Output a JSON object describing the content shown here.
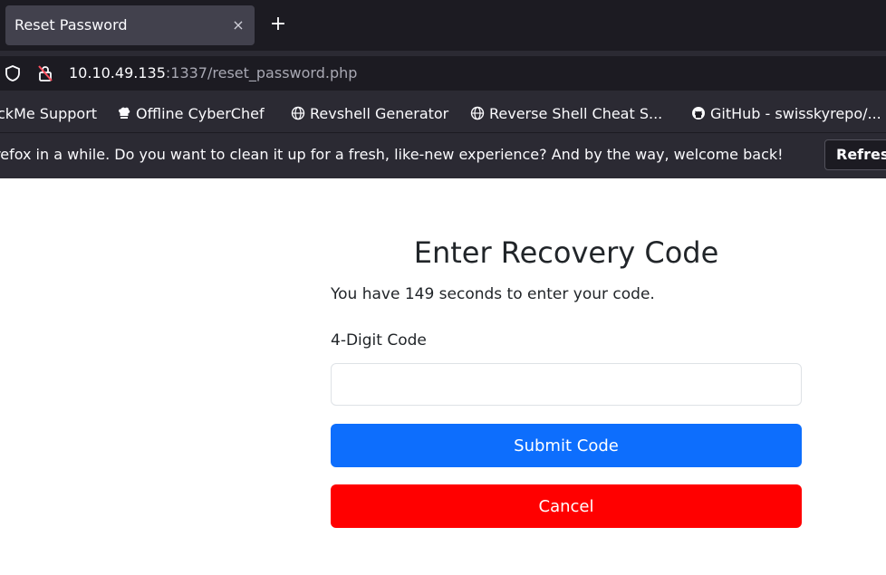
{
  "browser": {
    "tab": {
      "title": "Reset Password",
      "close_glyph": "×",
      "new_tab_glyph": "+"
    },
    "url": {
      "host": "10.10.49.135",
      "rest": ":1337/reset_password.php"
    },
    "bookmarks": [
      {
        "label": "ckMe Support",
        "icon": ""
      },
      {
        "label": "Offline CyberChef",
        "icon": "chef-hat-icon"
      },
      {
        "label": "Revshell Generator",
        "icon": "globe-icon"
      },
      {
        "label": "Reverse Shell Cheat S...",
        "icon": "globe-icon"
      },
      {
        "label": "GitHub - swisskyrepo/...",
        "icon": "github-icon"
      }
    ],
    "notification": {
      "text": "refox in a while. Do you want to clean it up for a fresh, like-new experience? And by the way, welcome back!",
      "button": "Refresh"
    }
  },
  "page": {
    "heading": "Enter Recovery Code",
    "timer_text": "You have 149 seconds to enter your code.",
    "code_label": "4-Digit Code",
    "code_value": "",
    "submit_label": "Submit Code",
    "cancel_label": "Cancel"
  },
  "colors": {
    "submit": "#0d6efd",
    "cancel": "#ff0000",
    "chrome_dark": "#1c1b22",
    "chrome": "#2b2a33"
  }
}
